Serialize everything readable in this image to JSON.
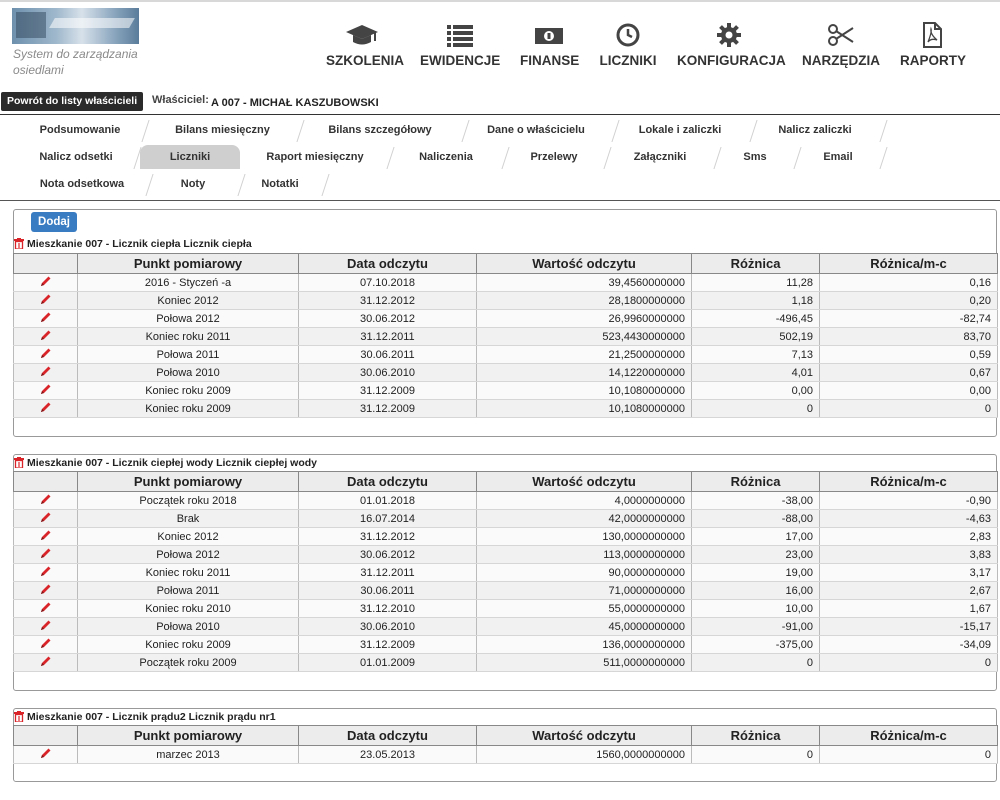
{
  "app": {
    "tagline": "System do zarządzania osiedlami"
  },
  "nav": [
    {
      "label": "SZKOLENIA",
      "icon": "graduation-cap-icon"
    },
    {
      "label": "EWIDENCJE",
      "icon": "list-icon"
    },
    {
      "label": "FINANSE",
      "icon": "money-icon"
    },
    {
      "label": "LICZNIKI",
      "icon": "clock-icon"
    },
    {
      "label": "KONFIGURACJA",
      "icon": "gear-icon"
    },
    {
      "label": "NARZĘDZIA",
      "icon": "scissors-icon"
    },
    {
      "label": "RAPORTY",
      "icon": "pdf-file-icon"
    }
  ],
  "owner": {
    "back_label": "Powrót do listy właścicieli",
    "label": "Właściciel:",
    "value": "A 007 - MICHAŁ KASZUBOWSKI"
  },
  "tabs": [
    [
      "Podsumowanie",
      "Bilans miesięczny",
      "Bilans szczegółowy",
      "Dane o właścicielu",
      "Lokale i zaliczki",
      "Nalicz zaliczki"
    ],
    [
      "Nalicz odsetki",
      "Liczniki",
      "Raport miesięczny",
      "Naliczenia",
      "Przelewy",
      "Załączniki",
      "Sms",
      "Email"
    ],
    [
      "Nota odsetkowa",
      "Noty",
      "Notatki"
    ]
  ],
  "active_tab": "Liczniki",
  "add_label": "Dodaj",
  "columns": [
    "Punkt pomiarowy",
    "Data odczytu",
    "Wartość odczytu",
    "Różnica",
    "Różnica/m-c"
  ],
  "sections": [
    {
      "title": "Mieszkanie 007 - Licznik ciepła Licznik ciepła",
      "rows": [
        [
          "2016 - Styczeń -a",
          "07.10.2018",
          "39,4560000000",
          "11,28",
          "0,16"
        ],
        [
          "Koniec 2012",
          "31.12.2012",
          "28,1800000000",
          "1,18",
          "0,20"
        ],
        [
          "Połowa 2012",
          "30.06.2012",
          "26,9960000000",
          "-496,45",
          "-82,74"
        ],
        [
          "Koniec roku 2011",
          "31.12.2011",
          "523,4430000000",
          "502,19",
          "83,70"
        ],
        [
          "Połowa 2011",
          "30.06.2011",
          "21,2500000000",
          "7,13",
          "0,59"
        ],
        [
          "Połowa 2010",
          "30.06.2010",
          "14,1220000000",
          "4,01",
          "0,67"
        ],
        [
          "Koniec roku 2009",
          "31.12.2009",
          "10,1080000000",
          "0,00",
          "0,00"
        ],
        [
          "Koniec roku 2009",
          "31.12.2009",
          "10,1080000000",
          "0",
          "0"
        ]
      ]
    },
    {
      "title": "Mieszkanie 007 - Licznik ciepłej wody Licznik ciepłej wody",
      "rows": [
        [
          "Początek roku 2018",
          "01.01.2018",
          "4,0000000000",
          "-38,00",
          "-0,90"
        ],
        [
          "Brak",
          "16.07.2014",
          "42,0000000000",
          "-88,00",
          "-4,63"
        ],
        [
          "Koniec 2012",
          "31.12.2012",
          "130,0000000000",
          "17,00",
          "2,83"
        ],
        [
          "Połowa 2012",
          "30.06.2012",
          "113,0000000000",
          "23,00",
          "3,83"
        ],
        [
          "Koniec roku 2011",
          "31.12.2011",
          "90,0000000000",
          "19,00",
          "3,17"
        ],
        [
          "Połowa 2011",
          "30.06.2011",
          "71,0000000000",
          "16,00",
          "2,67"
        ],
        [
          "Koniec roku 2010",
          "31.12.2010",
          "55,0000000000",
          "10,00",
          "1,67"
        ],
        [
          "Połowa 2010",
          "30.06.2010",
          "45,0000000000",
          "-91,00",
          "-15,17"
        ],
        [
          "Koniec roku 2009",
          "31.12.2009",
          "136,0000000000",
          "-375,00",
          "-34,09"
        ],
        [
          "Początek roku 2009",
          "01.01.2009",
          "511,0000000000",
          "0",
          "0"
        ]
      ]
    },
    {
      "title": "Mieszkanie 007 - Licznik prądu2 Licznik prądu nr1",
      "rows": [
        [
          "marzec 2013",
          "23.05.2013",
          "1560,0000000000",
          "0",
          "0"
        ]
      ]
    }
  ],
  "colors": {
    "accent": "#3a7cc1",
    "edit": "#d9252a",
    "trash": "#d9252a"
  }
}
